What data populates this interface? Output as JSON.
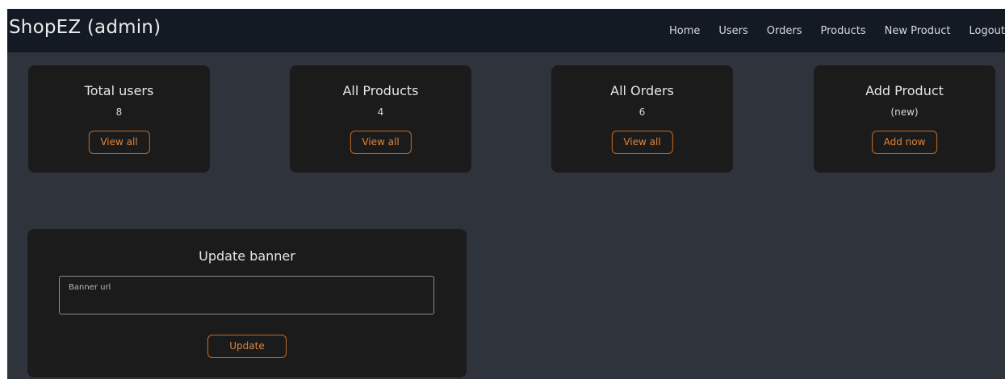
{
  "navbar": {
    "brand": "ShopEZ (admin)",
    "links": [
      "Home",
      "Users",
      "Orders",
      "Products",
      "New Product",
      "Logout"
    ]
  },
  "stats": [
    {
      "title": "Total users",
      "value": "8",
      "button": "View all"
    },
    {
      "title": "All Products",
      "value": "4",
      "button": "View all"
    },
    {
      "title": "All Orders",
      "value": "6",
      "button": "View all"
    },
    {
      "title": "Add Product",
      "value": "(new)",
      "button": "Add now"
    }
  ],
  "banner": {
    "title": "Update banner",
    "input_label": "Banner url",
    "input_value": "",
    "button": "Update"
  },
  "colors": {
    "navbar_bg": "#141a23",
    "page_bg": "#2f343c",
    "card_bg": "#1b1b1c",
    "accent": "#e08538"
  }
}
